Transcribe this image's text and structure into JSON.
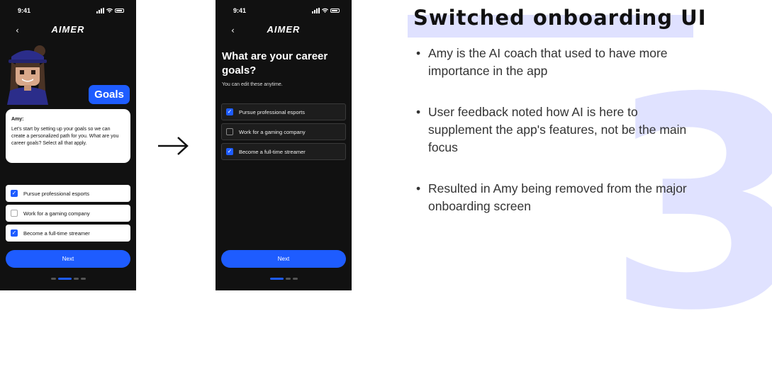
{
  "phone1": {
    "time": "9:41",
    "logo": "AIMER",
    "bubble_label": "Goals",
    "chat_name": "Amy:",
    "chat_text": "Let's start by setting up your goals so we can create a personalized path for you. What are you career goals? Select all that apply.",
    "options": [
      {
        "label": "Pursue professional esports",
        "checked": true
      },
      {
        "label": "Work for a gaming company",
        "checked": false
      },
      {
        "label": "Become a full-time streamer",
        "checked": true
      }
    ],
    "next_label": "Next",
    "page_indicator": {
      "pages": 4,
      "current": 2
    }
  },
  "phone2": {
    "time": "9:41",
    "logo": "AIMER",
    "question": "What are your career goals?",
    "subtitle": "You can edit these anytime.",
    "options": [
      {
        "label": "Pursue professional esports",
        "checked": true
      },
      {
        "label": "Work for a gaming company",
        "checked": false
      },
      {
        "label": "Become a full-time streamer",
        "checked": true
      }
    ],
    "next_label": "Next",
    "page_indicator": {
      "pages": 3,
      "current": 1
    }
  },
  "panel": {
    "title": "Switched onboarding UI",
    "step_number": "3",
    "bullets": [
      "Amy is the AI coach that used to have more importance in the app",
      "User feedback noted how AI is here to supplement the app's features, not be the main focus",
      "Resulted in Amy being removed from the major onboarding screen"
    ]
  },
  "colors": {
    "accent": "#1e5cff",
    "phone_bg": "#111111",
    "highlight": "#dfe1ff",
    "number_tint": "#d9dbff"
  },
  "icons": {
    "back": "chevron-left-icon",
    "check": "checkmark-icon",
    "transition": "arrow-right-icon"
  }
}
